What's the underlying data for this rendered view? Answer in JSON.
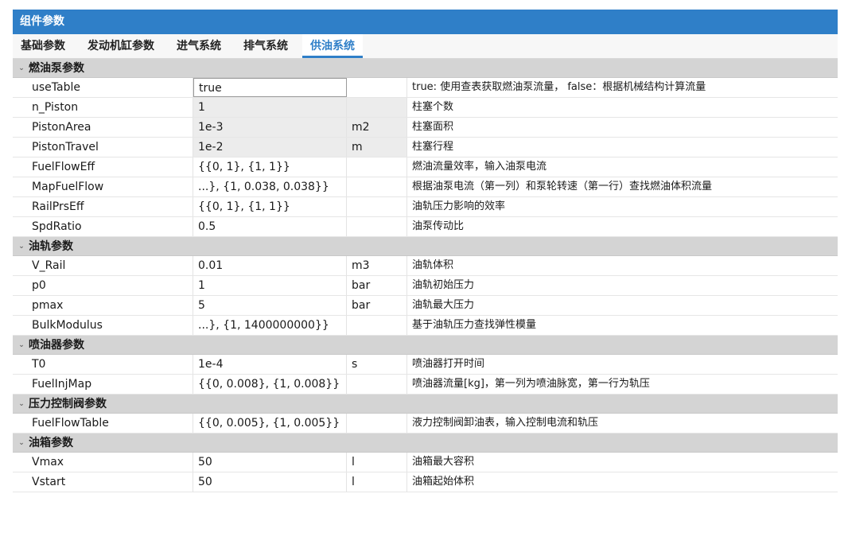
{
  "panel": {
    "title": "组件参数"
  },
  "tabs": [
    {
      "label": "基础参数"
    },
    {
      "label": "发动机缸参数"
    },
    {
      "label": "进气系统"
    },
    {
      "label": "排气系统"
    },
    {
      "label": "供油系统"
    }
  ],
  "active_tab_index": 4,
  "icons": {
    "group_toggle": "chevron-down-icon"
  },
  "colors": {
    "accent": "#2f7fc8",
    "group_bg": "#d4d4d4",
    "readonly_bg": "#ececec"
  },
  "groups": [
    {
      "title": "燃油泵参数",
      "rows": [
        {
          "name": "useTable",
          "value": "true",
          "unit": "",
          "desc": "true: 使用查表获取燃油泵流量， false：根据机械结构计算流量",
          "editing": true,
          "readonly": false
        },
        {
          "name": "n_Piston",
          "value": "1",
          "unit": "",
          "desc": "柱塞个数",
          "editing": false,
          "readonly": true
        },
        {
          "name": "PistonArea",
          "value": "1e-3",
          "unit": "m2",
          "desc": "柱塞面积",
          "editing": false,
          "readonly": true
        },
        {
          "name": "PistonTravel",
          "value": "1e-2",
          "unit": "m",
          "desc": "柱塞行程",
          "editing": false,
          "readonly": true
        },
        {
          "name": "FuelFlowEff",
          "value": "{{0, 1}, {1, 1}}",
          "unit": "",
          "desc": "燃油流量效率，输入油泵电流",
          "editing": false,
          "readonly": false
        },
        {
          "name": "MapFuelFlow",
          "value": "...}, {1, 0.038, 0.038}}",
          "unit": "",
          "desc": "根据油泵电流（第一列）和泵轮转速（第一行）查找燃油体积流量",
          "editing": false,
          "readonly": false
        },
        {
          "name": "RailPrsEff",
          "value": "{{0, 1}, {1, 1}}",
          "unit": "",
          "desc": "油轨压力影响的效率",
          "editing": false,
          "readonly": false
        },
        {
          "name": "SpdRatio",
          "value": "0.5",
          "unit": "",
          "desc": "油泵传动比",
          "editing": false,
          "readonly": false
        }
      ]
    },
    {
      "title": "油轨参数",
      "rows": [
        {
          "name": "V_Rail",
          "value": "0.01",
          "unit": "m3",
          "desc": "油轨体积",
          "editing": false,
          "readonly": false
        },
        {
          "name": "p0",
          "value": "1",
          "unit": "bar",
          "desc": "油轨初始压力",
          "editing": false,
          "readonly": false
        },
        {
          "name": "pmax",
          "value": "5",
          "unit": "bar",
          "desc": "油轨最大压力",
          "editing": false,
          "readonly": false
        },
        {
          "name": "BulkModulus",
          "value": "...}, {1, 1400000000}}",
          "unit": "",
          "desc": "基于油轨压力查找弹性模量",
          "editing": false,
          "readonly": false
        }
      ]
    },
    {
      "title": "喷油器参数",
      "rows": [
        {
          "name": "T0",
          "value": "1e-4",
          "unit": "s",
          "desc": "喷油器打开时间",
          "editing": false,
          "readonly": false
        },
        {
          "name": "FuelInjMap",
          "value": "{{0, 0.008}, {1, 0.008}}",
          "unit": "",
          "desc": "喷油器流量[kg]，第一列为喷油脉宽，第一行为轨压",
          "editing": false,
          "readonly": false
        }
      ]
    },
    {
      "title": "压力控制阀参数",
      "rows": [
        {
          "name": "FuelFlowTable",
          "value": "{{0, 0.005}, {1, 0.005}}",
          "unit": "",
          "desc": "液力控制阀卸油表，输入控制电流和轨压",
          "editing": false,
          "readonly": false
        }
      ]
    },
    {
      "title": "油箱参数",
      "rows": [
        {
          "name": "Vmax",
          "value": "50",
          "unit": "l",
          "desc": "油箱最大容积",
          "editing": false,
          "readonly": false
        },
        {
          "name": "Vstart",
          "value": "50",
          "unit": "l",
          "desc": "油箱起始体积",
          "editing": false,
          "readonly": false
        }
      ]
    }
  ]
}
